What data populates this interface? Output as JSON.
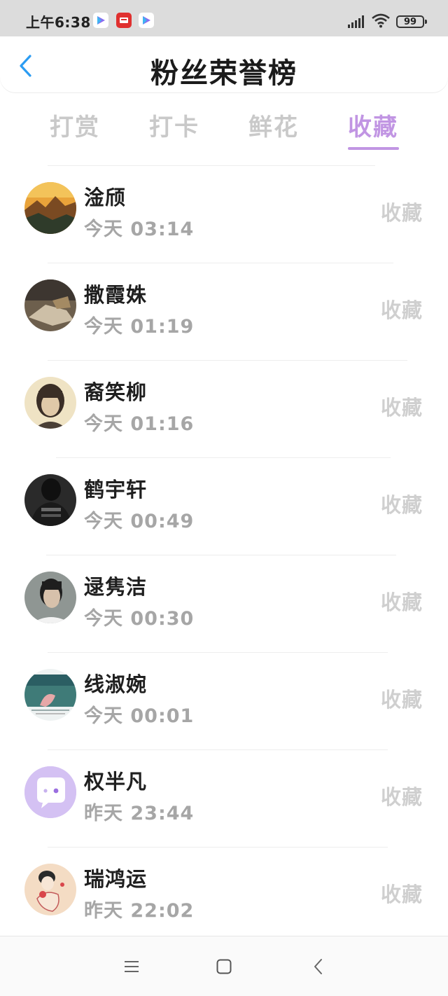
{
  "status_bar": {
    "time": "上午6:38",
    "battery": "99",
    "apps": [
      "play-app-icon",
      "news-app-icon",
      "play-app-icon"
    ]
  },
  "header": {
    "title": "粉丝荣誉榜",
    "back_icon": "chevron-left-icon"
  },
  "tabs": [
    {
      "label": "打赏",
      "active": false
    },
    {
      "label": "打卡",
      "active": false
    },
    {
      "label": "鲜花",
      "active": false
    },
    {
      "label": "收藏",
      "active": true
    }
  ],
  "colors": {
    "accent": "#c195e3",
    "back_arrow": "#2b9cf2",
    "inactive_tab": "#c9c9c9",
    "muted_text": "#a6a6a6"
  },
  "fans": [
    {
      "name": "淦颀",
      "time": "今天 03:14",
      "type": "收藏",
      "avatar": "landscape-avatar"
    },
    {
      "name": "撒霞姝",
      "time": "今天 01:19",
      "type": "收藏",
      "avatar": "photo-avatar"
    },
    {
      "name": "裔笑柳",
      "time": "今天 01:16",
      "type": "收藏",
      "avatar": "portrait-avatar"
    },
    {
      "name": "鹤宇轩",
      "time": "今天 00:49",
      "type": "收藏",
      "avatar": "dark-portrait-avatar"
    },
    {
      "name": "逯隽洁",
      "time": "今天 00:30",
      "type": "收藏",
      "avatar": "portrait-avatar"
    },
    {
      "name": "线淑婉",
      "time": "今天 00:01",
      "type": "收藏",
      "avatar": "scenery-avatar"
    },
    {
      "name": "权半凡",
      "time": "昨天 23:44",
      "type": "收藏",
      "avatar": "default-chat-avatar"
    },
    {
      "name": "瑞鸿运",
      "time": "昨天 22:02",
      "type": "收藏",
      "avatar": "illustration-avatar"
    }
  ],
  "nav_bar": {
    "items": [
      "menu-icon",
      "home-square-icon",
      "back-chevron-icon"
    ]
  }
}
